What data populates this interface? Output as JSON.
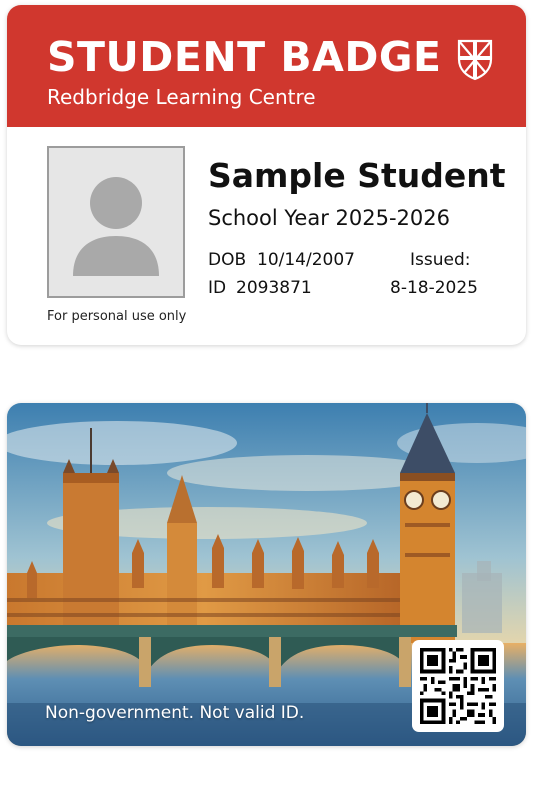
{
  "front": {
    "title": "STUDENT BADGE",
    "institution": "Redbridge Learning Centre",
    "student_name": "Sample Student",
    "school_year": "School Year 2025-2026",
    "dob_label": "DOB",
    "dob_value": "10/14/2007",
    "id_label": "ID",
    "id_value": "2093871",
    "issued_label": "Issued:",
    "issued_value": "8-18-2025",
    "personal_note": "For personal use only"
  },
  "back": {
    "disclaimer": "Non-government. Not valid ID."
  },
  "icons": {
    "crest": "shield-union-flag-icon",
    "photo": "person-silhouette-icon",
    "qr": "qr-code"
  },
  "colors": {
    "header": "#d0372e",
    "photo_bg": "#e6e6e6",
    "silhouette": "#a9a9a9"
  }
}
